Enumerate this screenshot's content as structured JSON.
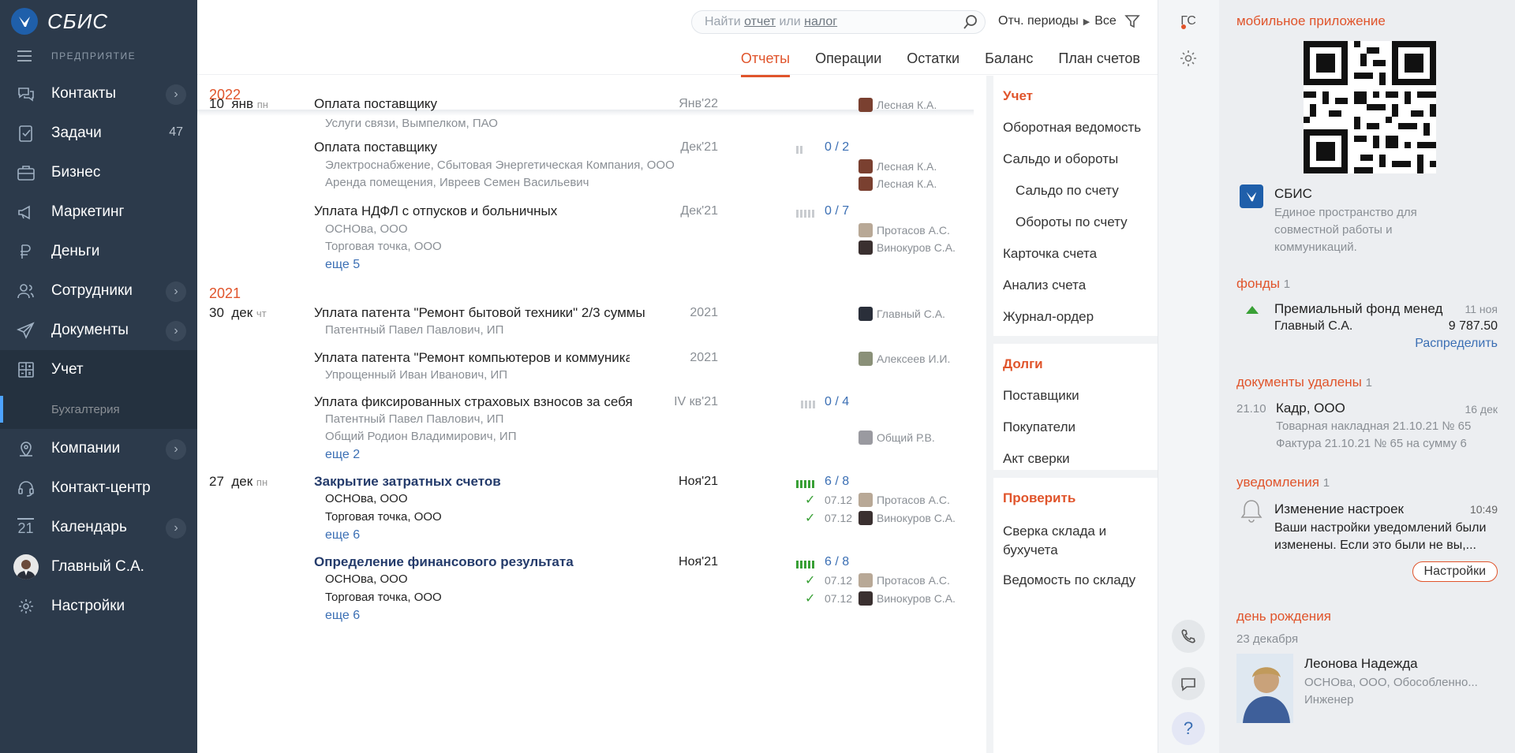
{
  "app": {
    "name": "СБИС",
    "company_label": "ПРЕДПРИЯТИЕ"
  },
  "sidebar": {
    "items": [
      {
        "label": "Контакты",
        "icon": "chat-bubbles-icon",
        "chevron": true
      },
      {
        "label": "Задачи",
        "icon": "tasks-icon",
        "count": "47"
      },
      {
        "label": "Бизнес",
        "icon": "briefcase-icon"
      },
      {
        "label": "Маркетинг",
        "icon": "megaphone-icon"
      },
      {
        "label": "Деньги",
        "icon": "ruble-icon"
      },
      {
        "label": "Сотрудники",
        "icon": "users-icon",
        "chevron": true
      },
      {
        "label": "Документы",
        "icon": "paper-plane-icon",
        "chevron": true
      },
      {
        "label": "Учет",
        "icon": "calculator-icon",
        "active": true
      },
      {
        "label": "Бухгалтерия",
        "sub": true
      },
      {
        "label": "Компании",
        "icon": "location-icon",
        "chevron": true
      },
      {
        "label": "Контакт-центр",
        "icon": "headset-icon"
      },
      {
        "label": "Календарь",
        "icon": "calendar-icon",
        "icon_text": "21",
        "chevron": true
      },
      {
        "label": "Главный С.А.",
        "icon": "user-avatar"
      },
      {
        "label": "Настройки",
        "icon": "gear-icon"
      }
    ]
  },
  "search": {
    "prefix": "Найти",
    "link1": "отчет",
    "mid": "или",
    "link2": "налог"
  },
  "periods": {
    "label": "Отч. периоды",
    "value": "Все"
  },
  "tabs": [
    "Отчеты",
    "Операции",
    "Остатки",
    "Баланс",
    "План счетов"
  ],
  "list": {
    "years": [
      "2022",
      "2021"
    ],
    "dates": [
      {
        "day": "10",
        "month": "янв",
        "dow": "пн"
      },
      {
        "day": "30",
        "month": "дек",
        "dow": "чт"
      },
      {
        "day": "27",
        "month": "дек",
        "dow": "пн"
      }
    ],
    "rows": [
      {
        "title": "Оплата поставщику",
        "period": "Янв'22",
        "person": "Лесная К.А.",
        "subs": [
          {
            "text": "Услуги связи, Вымпелком, ПАО"
          }
        ]
      },
      {
        "title": "Оплата поставщику",
        "period": "Дек'21",
        "progress": "0 / 2",
        "subs": [
          {
            "text": "Электроснабжение, Сбытовая Энергетическая Компания, ООО",
            "person": "Лесная К.А."
          },
          {
            "text": "Аренда помещения, Ивреев Семен Васильевич",
            "person": "Лесная К.А."
          }
        ]
      },
      {
        "title": "Уплата НДФЛ с отпусков и больничных",
        "period": "Дек'21",
        "progress": "0 / 7",
        "subs": [
          {
            "text": "ОСНОва, ООО",
            "person": "Протасов А.С."
          },
          {
            "text": "Торговая точка, ООО",
            "person": "Винокуров С.А."
          }
        ],
        "more": "еще 5"
      },
      {
        "title": "Уплата патента \"Ремонт бытовой техники\" 2/3 суммы",
        "period": "2021",
        "person": "Главный С.А.",
        "subs": [
          {
            "text": "Патентный Павел Павлович, ИП"
          }
        ]
      },
      {
        "title": "Уплата патента \"Ремонт компьютеров и коммуникацион...",
        "period": "2021",
        "person": "Алексеев И.И.",
        "subs": [
          {
            "text": "Упрощенный Иван Иванович, ИП"
          }
        ]
      },
      {
        "title": "Уплата фиксированных страховых взносов за себя",
        "period": "IV кв'21",
        "progress": "0 / 4",
        "subs": [
          {
            "text": "Патентный Павел Павлович, ИП"
          },
          {
            "text": "Общий Родион Владимирович, ИП",
            "person": "Общий Р.В."
          }
        ],
        "more": "еще 2"
      },
      {
        "title": "Закрытие затратных счетов",
        "period": "Ноя'21",
        "progress": "6 / 8",
        "subs": [
          {
            "text": "ОСНОва, ООО",
            "date": "07.12",
            "person": "Протасов А.С."
          },
          {
            "text": "Торговая точка, ООО",
            "date": "07.12",
            "person": "Винокуров С.А."
          }
        ],
        "more": "еще 6"
      },
      {
        "title": "Определение финансового результата",
        "period": "Ноя'21",
        "progress": "6 / 8",
        "subs": [
          {
            "text": "ОСНОва, ООО",
            "date": "07.12",
            "person": "Протасов А.С."
          },
          {
            "text": "Торговая точка, ООО",
            "date": "07.12",
            "person": "Винокуров С.А."
          }
        ],
        "more": "еще 6"
      }
    ]
  },
  "sidemenu": {
    "uchet": {
      "header": "Учет",
      "items": [
        "Оборотная ведомость",
        "Сальдо и обороты",
        "Сальдо по счету",
        "Обороты по счету",
        "Карточка счета",
        "Анализ счета",
        "Журнал-ордер"
      ]
    },
    "dolgi": {
      "header": "Долги",
      "items": [
        "Поставщики",
        "Покупатели",
        "Акт сверки"
      ]
    },
    "check": {
      "header": "Проверить",
      "items": [
        "Сверка склада и",
        "бухучета",
        "Ведомость по складу"
      ]
    }
  },
  "toolcol": {
    "user_initials": "ГС"
  },
  "rpanel": {
    "mobile": {
      "header": "мобильное приложение",
      "app_title": "СБИС",
      "app_desc": [
        "Единое пространство для",
        "совместной работы и",
        "коммуникаций."
      ]
    },
    "funds": {
      "header": "фонды",
      "count": "1",
      "name": "Премиальный фонд менед",
      "date": "11 ноя",
      "owner": "Главный С.А.",
      "amount": "9 787.50",
      "action": "Распределить"
    },
    "deleted": {
      "header": "документы удалены",
      "count": "1",
      "date_left": "21.10",
      "company": "Кадр, ООО",
      "date_right": "16 дек",
      "docs": [
        "Товарная накладная 21.10.21 № 65",
        "Фактура 21.10.21 № 65 на сумму 6"
      ]
    },
    "notif": {
      "header": "уведомления",
      "count": "1",
      "title": "Изменение настроек",
      "time": "10:49",
      "text": [
        "Ваши настройки уведомлений были",
        "изменены. Если это были не вы,..."
      ],
      "button": "Настройки"
    },
    "birthday": {
      "header": "день рождения",
      "date": "23 декабря",
      "name": "Леонова Надежда",
      "org": "ОСНОва, ООО, Обособленно...",
      "role": "Инженер"
    }
  },
  "colors": {
    "accent": "#e0542b",
    "sidebar": "#2c3a4b",
    "link": "#3b6fb4",
    "progress_green": "#39a036"
  }
}
